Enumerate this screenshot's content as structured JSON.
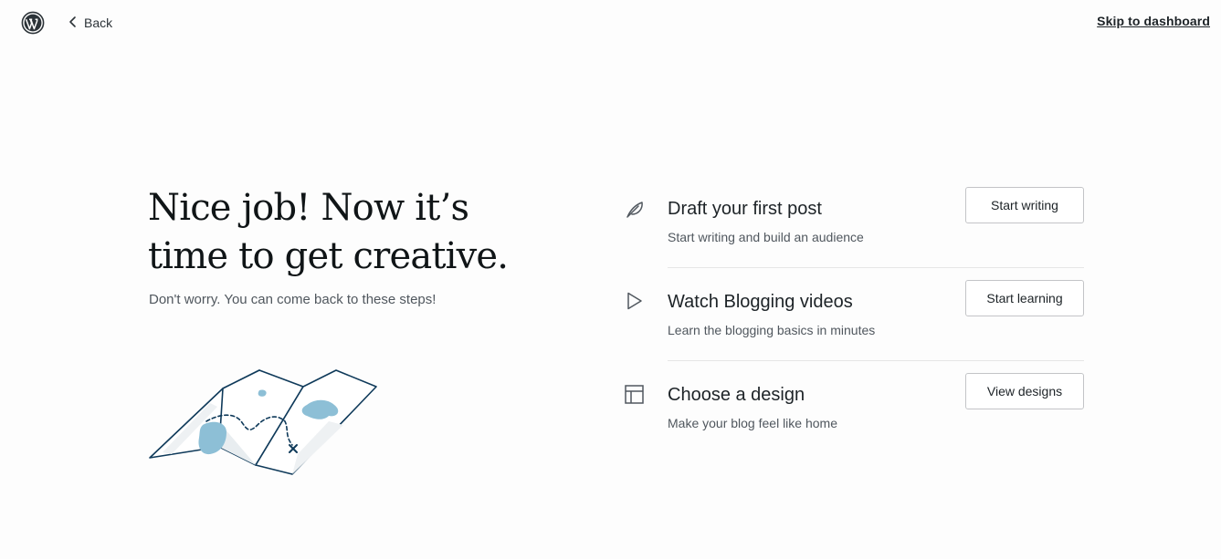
{
  "topbar": {
    "logo_icon": "wordpress-logo-icon",
    "back_label": "Back",
    "skip_label": "Skip to dashboard"
  },
  "hero": {
    "headline_line1": "Nice job! Now it’s",
    "headline_line2": "time to get creative.",
    "subtitle": "Don't worry. You can come back to these steps!",
    "illustration": "map-illustration"
  },
  "steps": [
    {
      "icon": "feather-icon",
      "title": "Draft your first post",
      "description": "Start writing and build an audience",
      "button": "Start writing"
    },
    {
      "icon": "play-icon",
      "title": "Watch Blogging videos",
      "description": "Learn the blogging basics in minutes",
      "button": "Start learning"
    },
    {
      "icon": "layout-icon",
      "title": "Choose a design",
      "description": "Make your blog feel like home",
      "button": "View designs"
    }
  ],
  "colors": {
    "map_outline": "#0f3a5a",
    "map_water": "#8dbfd6"
  }
}
